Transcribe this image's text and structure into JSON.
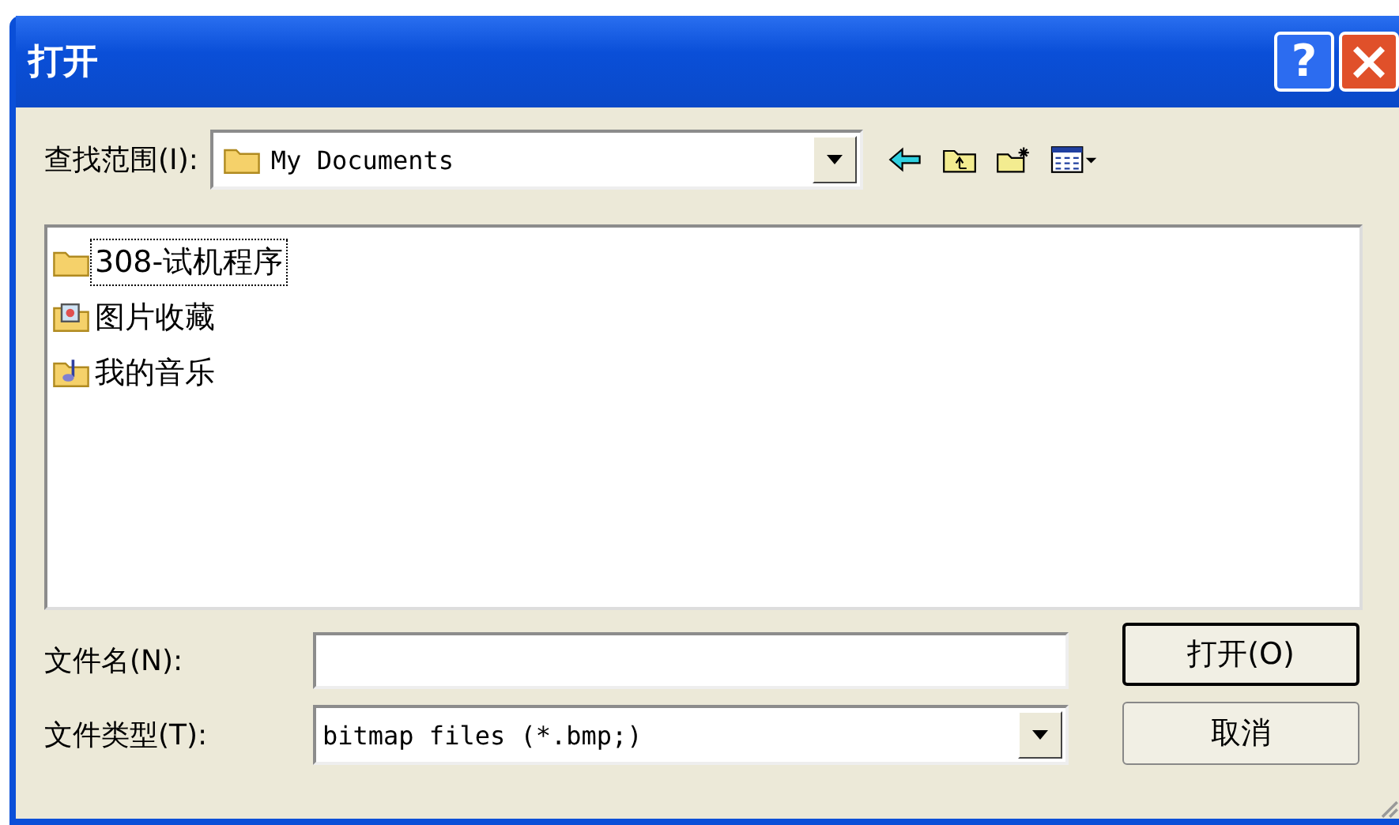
{
  "window": {
    "title": "打开",
    "buttons": [
      "?",
      "×"
    ]
  },
  "look_in": {
    "label": "查找范围(I):",
    "value": "My Documents"
  },
  "files": [
    {
      "name": "308-试机程序",
      "kind": "folder",
      "focused": true
    },
    {
      "name": "图片收藏",
      "kind": "pictures",
      "focused": false
    },
    {
      "name": "我的音乐",
      "kind": "music",
      "focused": false
    }
  ],
  "file_name": {
    "label": "文件名(N):"
  },
  "file_type": {
    "label": "文件类型(T):",
    "value": "bitmap files (*.bmp;)"
  },
  "buttons": [
    {
      "label": "打开(O)",
      "default": true
    },
    {
      "label": "取消",
      "default": false
    }
  ]
}
